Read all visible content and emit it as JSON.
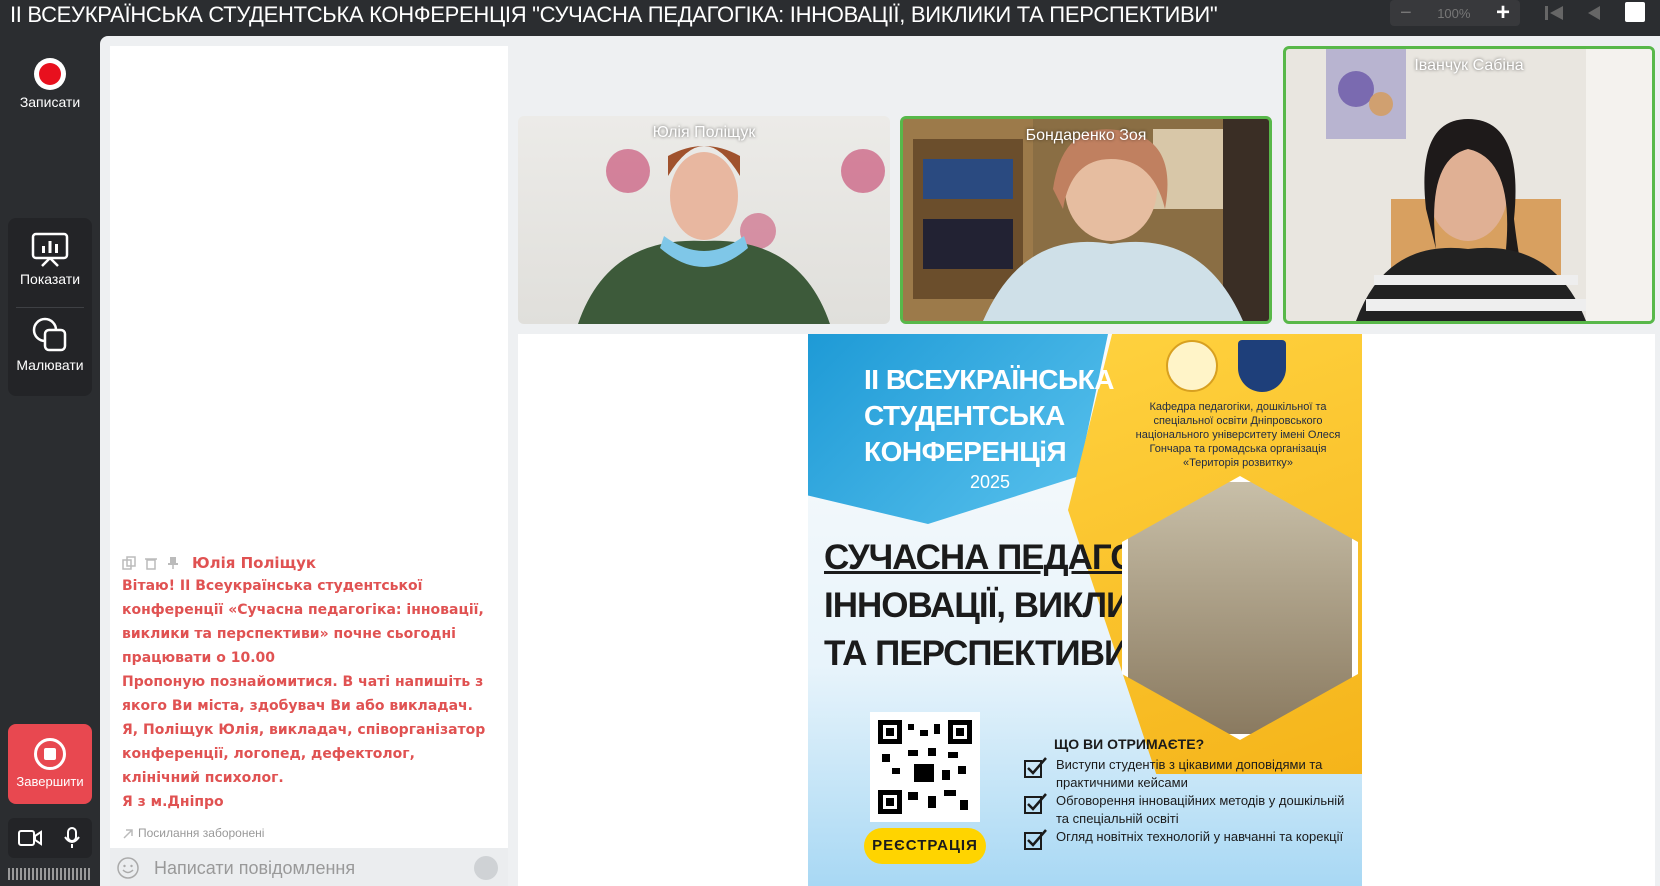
{
  "window": {
    "title": "ІІ ВСЕУКРАЇНСЬКА СТУДЕНТСЬКА КОНФЕРЕНЦІЯ \"СУЧАСНА ПЕДАГОГІКА: ІННОВАЦІЇ, ВИКЛИКИ ТА ПЕРСПЕКТИВИ\"",
    "zoom": "100%"
  },
  "sidebar": {
    "record_label": "Записати",
    "show_label": "Показати",
    "draw_label": "Малювати",
    "end_label": "Завершити"
  },
  "chat": {
    "message": {
      "author": "Юлія Поліщук",
      "lines": [
        "Вітаю! ІІ Всеукраїнська студентської",
        "конференції «Сучасна педагогіка: інновації,",
        "виклики та перспективи» почне сьогодні",
        "працювати о 10.00",
        "Пропоную познайомитися. В чаті напишіть з",
        "якого Ви міста, здобувач Ви або викладач.",
        "Я, Поліщук Юлія, викладач, співорганізатор",
        "конференції, логопед, дефектолог,",
        "клінічний психолог.",
        "Я з м.Дніпро"
      ]
    },
    "links_note": "Посилання заборонені",
    "input_placeholder": "Написати повідомлення"
  },
  "participants": [
    {
      "name": "Юлія Поліщук"
    },
    {
      "name": "Бондаренко Зоя"
    },
    {
      "name": "Іванчук Сабіна"
    }
  ],
  "poster": {
    "header_lines": [
      "ІІ ВСЕУКРАЇНСЬКА",
      "СТУДЕНТСЬКА",
      "КОНФЕРЕНЦіЯ"
    ],
    "year": "2025",
    "dept": "Кафедра педагогіки, дошкільної та спеціальної освіти Дніпровського національного університету імені Олеся Гончара та громадська організація «Територія розвитку»",
    "title_lines": [
      "СУЧАСНА ПЕДАГОГІКА:",
      "ІННОВАЦІЇ, ВИКЛИКИ",
      "ТА ПЕРСПЕКТИВИ"
    ],
    "register": "РЕЄСТРАЦІЯ",
    "benefits_heading": "ЩО ВИ ОТРИМАЄТЕ?",
    "benefits": [
      "Виступи студентів з цікавими доповідями та практичними кейсами",
      "Обговорення інноваційних методів у дошкільній та спеціальній освіті",
      "Огляд новітніх технологій у навчанні та корекції"
    ]
  },
  "colors": {
    "accent_red": "#e8101e",
    "end_button": "#e84850",
    "active_speaker": "#58b84a",
    "chat_text": "#e05252"
  }
}
